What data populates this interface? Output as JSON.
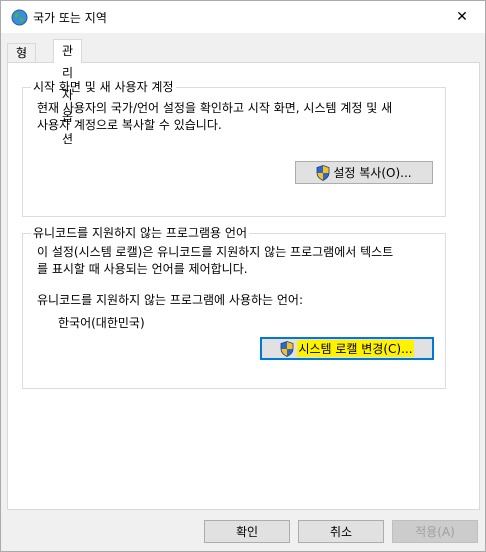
{
  "window": {
    "title": "국가 또는 지역",
    "close_glyph": "✕"
  },
  "tabs": [
    {
      "label": "형식",
      "active": false
    },
    {
      "label": "관리자 옵션",
      "active": true
    }
  ],
  "group_welcome": {
    "title": "시작 화면 및 새 사용자 계정",
    "description_line1": "현재 사용자의 국가/언어 설정을 확인하고 시작 화면, 시스템 계정 및 새",
    "description_line2": "사용자 계정으로 복사할 수 있습니다.",
    "copy_button_label": "설정 복사(O)..."
  },
  "group_nonunicode": {
    "title": "유니코드를 지원하지 않는 프로그램용 언어",
    "description_line1": "이 설정(시스템 로캘)은 유니코드를 지원하지 않는 프로그램에서 텍스트",
    "description_line2": "를 표시할 때 사용되는 언어를 제어합니다.",
    "current_label": "유니코드를 지원하지 않는 프로그램에 사용하는 언어:",
    "current_value": "한국어(대한민국)",
    "change_button_label": "시스템 로캘 변경(C)..."
  },
  "footer": {
    "ok_label": "확인",
    "cancel_label": "취소",
    "apply_label": "적용(A)"
  },
  "colors": {
    "highlight": "#fff200",
    "focus_border": "#0078d7",
    "button_bg": "#e1e1e1"
  },
  "icons": {
    "title": "globe-icon",
    "shield": "uac-shield-icon",
    "close": "close-icon"
  }
}
